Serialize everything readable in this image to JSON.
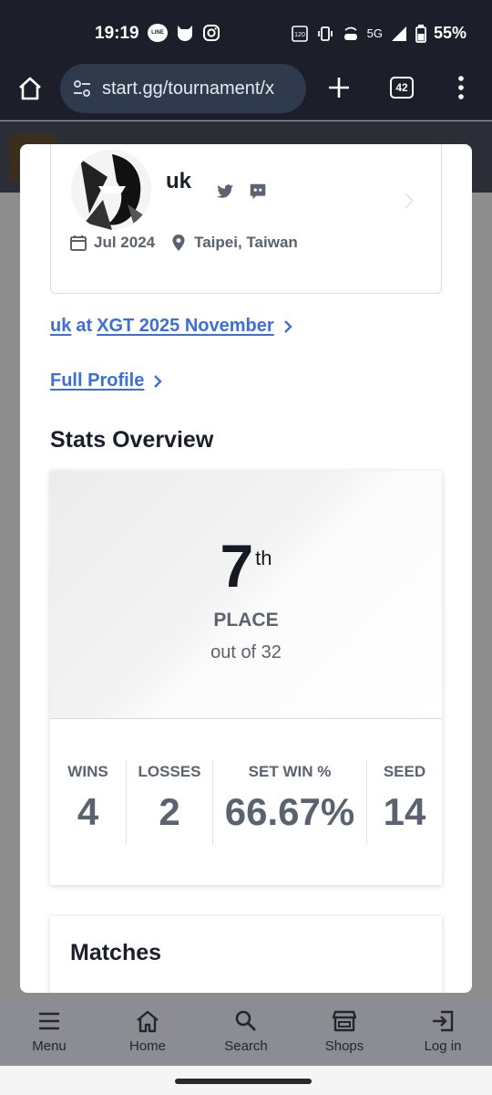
{
  "status_bar": {
    "time": "19:19",
    "notifications": [
      "line-icon",
      "cat-icon",
      "instagram-icon"
    ],
    "refresh_rate": "120",
    "network": "5G",
    "battery": "55%"
  },
  "browser": {
    "url": "start.gg/tournament/x",
    "tab_count": "42"
  },
  "profile": {
    "username": "uk",
    "joined": "Jul 2024",
    "location": "Taipei, Taiwan"
  },
  "links": {
    "entrant_name": "uk",
    "entrant_at": "at",
    "tournament": "XGT 2025 November",
    "full_profile": "Full Profile"
  },
  "stats": {
    "section_title": "Stats Overview",
    "place": "7",
    "place_suffix": "th",
    "place_label": "PLACE",
    "out_of": "out of 32",
    "columns": [
      {
        "label": "WINS",
        "value": "4"
      },
      {
        "label": "LOSSES",
        "value": "2"
      },
      {
        "label": "SET WIN %",
        "value": "66.67%"
      },
      {
        "label": "SEED",
        "value": "14"
      }
    ]
  },
  "matches": {
    "title": "Matches"
  },
  "bottom_nav": [
    {
      "label": "Menu",
      "icon": "menu-icon"
    },
    {
      "label": "Home",
      "icon": "home-icon"
    },
    {
      "label": "Search",
      "icon": "search-icon"
    },
    {
      "label": "Shops",
      "icon": "shop-icon"
    },
    {
      "label": "Log in",
      "icon": "login-icon"
    }
  ],
  "colors": {
    "link": "#3d6fd6",
    "chrome_bg": "#1c1f2a",
    "url_bar": "#2f3a4c",
    "text_dark": "#1a1f2b",
    "text_muted": "#5c6370"
  }
}
